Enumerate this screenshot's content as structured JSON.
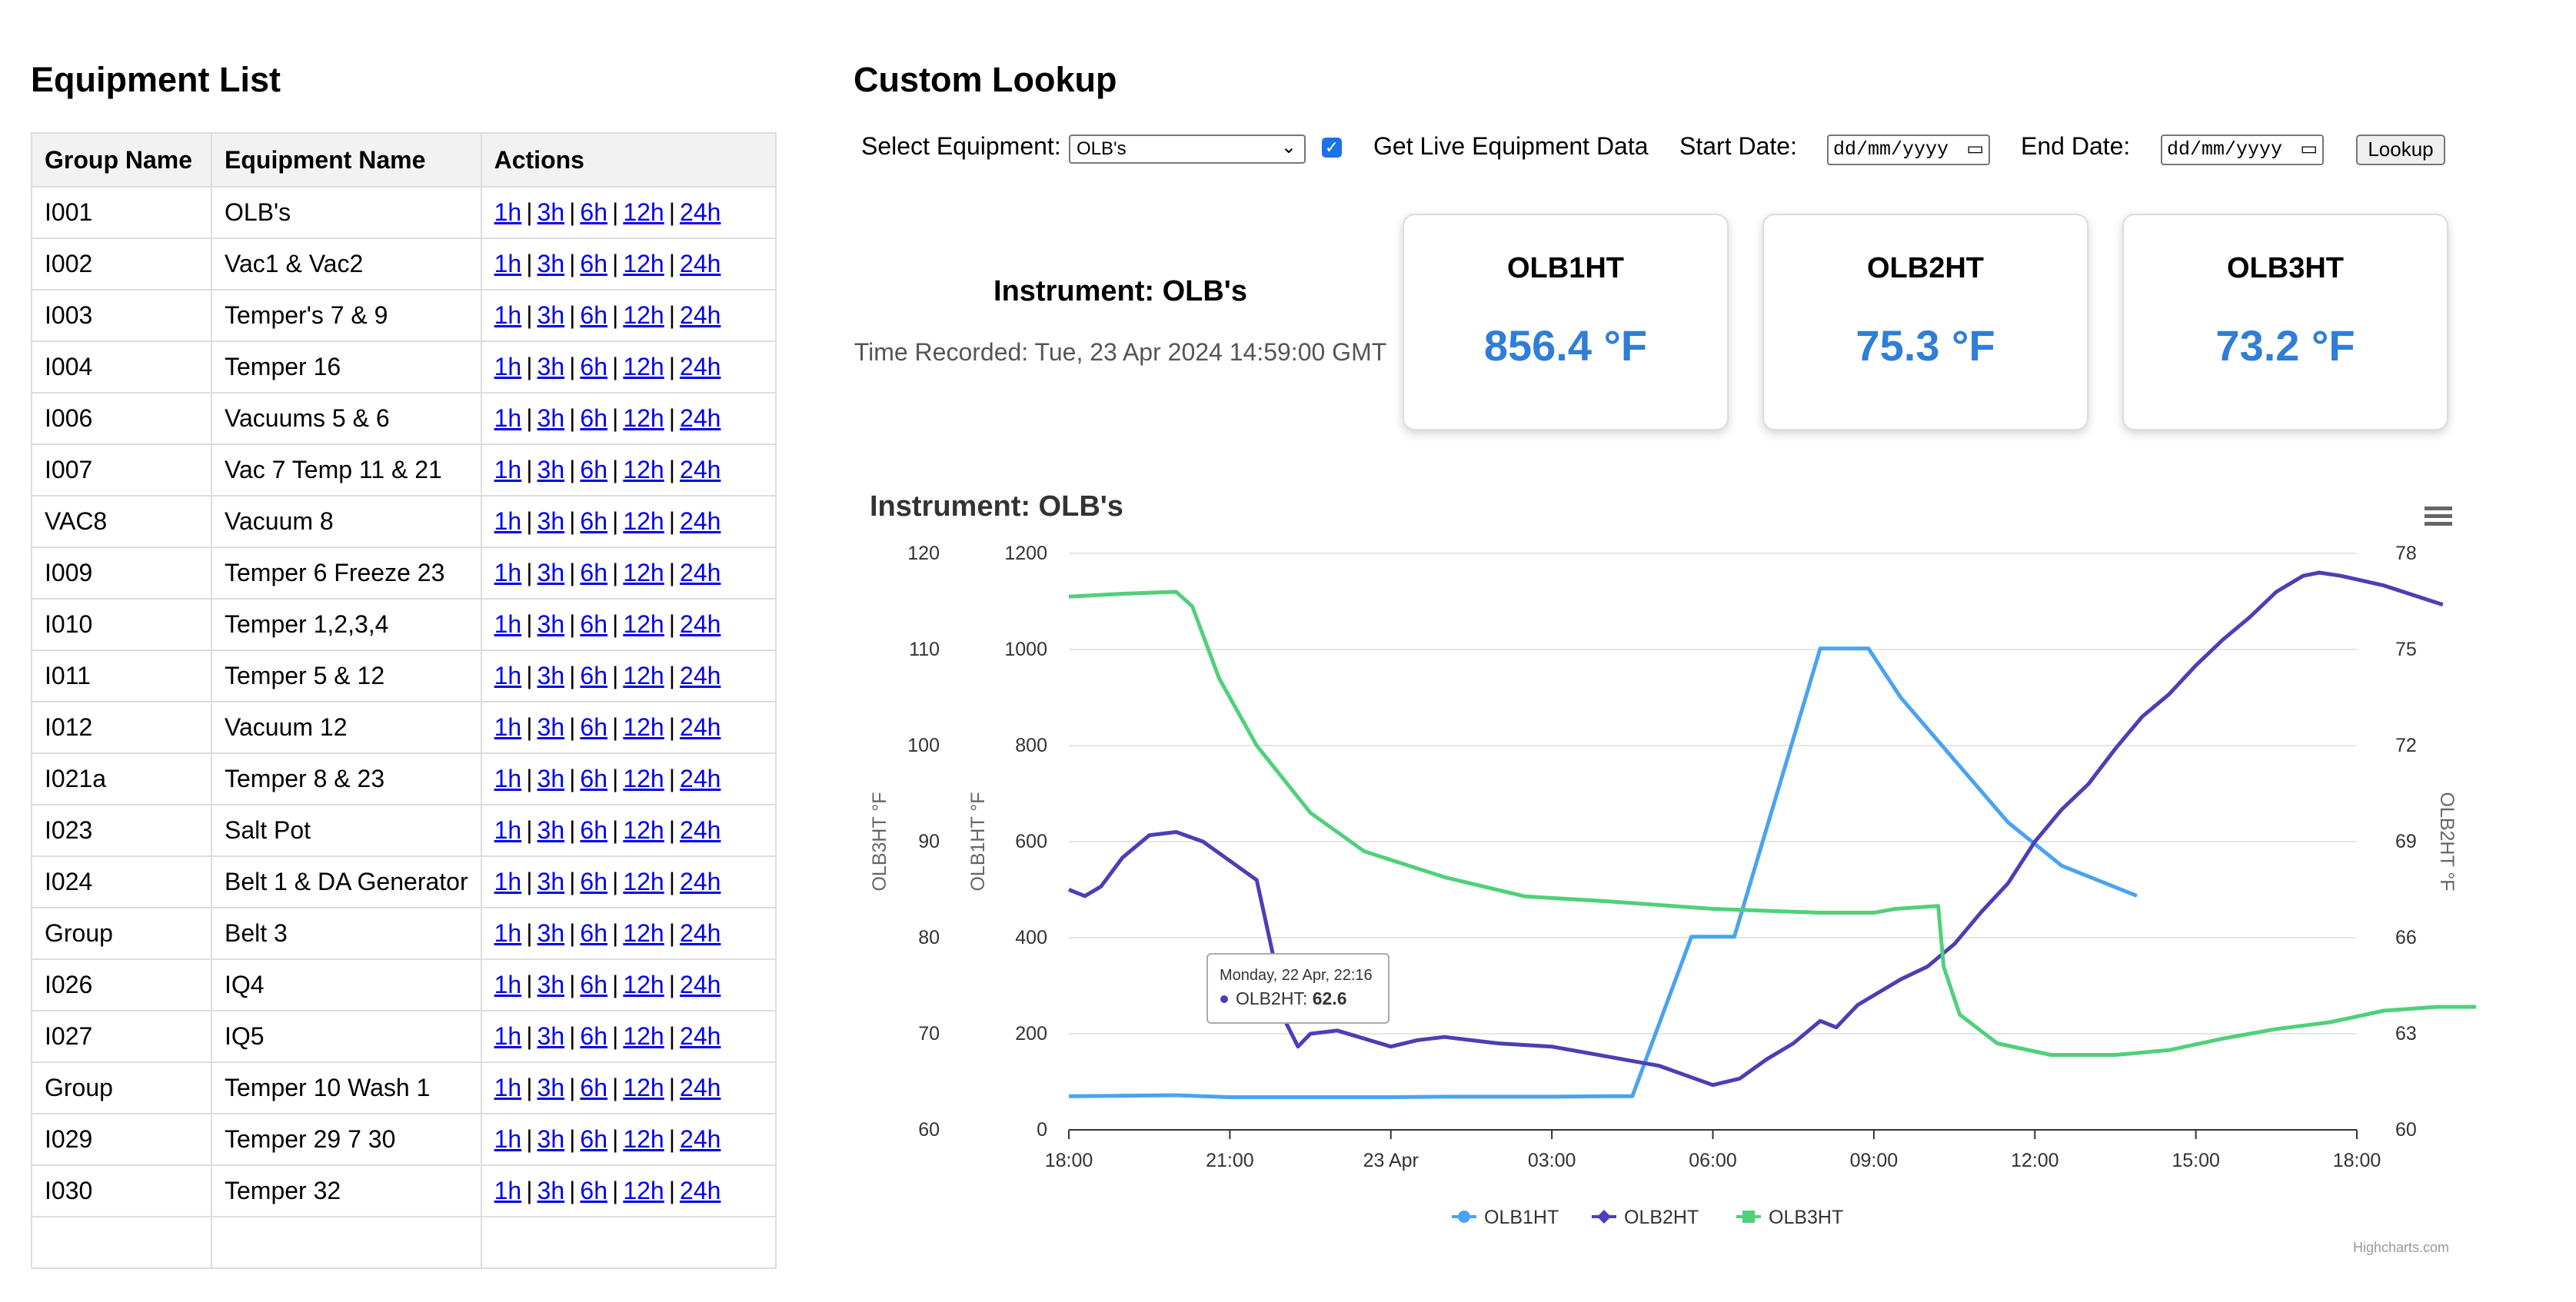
{
  "equipment_list": {
    "title": "Equipment List",
    "headers": [
      "Group Name",
      "Equipment Name",
      "Actions"
    ],
    "actions": [
      "1h",
      "3h",
      "6h",
      "12h",
      "24h"
    ],
    "rows": [
      {
        "group": "I001",
        "name": "OLB's"
      },
      {
        "group": "I002",
        "name": "Vac1 & Vac2"
      },
      {
        "group": "I003",
        "name": "Temper's 7 & 9"
      },
      {
        "group": "I004",
        "name": "Temper 16"
      },
      {
        "group": "I006",
        "name": "Vacuums 5 & 6"
      },
      {
        "group": "I007",
        "name": "Vac 7 Temp 11 & 21"
      },
      {
        "group": "VAC8",
        "name": "Vacuum 8"
      },
      {
        "group": "I009",
        "name": "Temper 6 Freeze 23"
      },
      {
        "group": "I010",
        "name": "Temper 1,2,3,4"
      },
      {
        "group": "I011",
        "name": "Temper 5 & 12"
      },
      {
        "group": "I012",
        "name": "Vacuum 12"
      },
      {
        "group": "I021a",
        "name": "Temper 8 & 23"
      },
      {
        "group": "I023",
        "name": "Salt Pot"
      },
      {
        "group": "I024",
        "name": "Belt 1 & DA Generator"
      },
      {
        "group": "Group",
        "name": "Belt 3"
      },
      {
        "group": "I026",
        "name": "IQ4"
      },
      {
        "group": "I027",
        "name": "IQ5"
      },
      {
        "group": "Group",
        "name": "Temper 10 Wash 1"
      },
      {
        "group": "I029",
        "name": "Temper 29 7 30"
      },
      {
        "group": "I030",
        "name": "Temper 32"
      },
      {
        "group": "",
        "name": ""
      }
    ]
  },
  "custom_lookup": {
    "title": "Custom Lookup",
    "select_label": "Select Equipment:",
    "select_value": "OLB's",
    "live_checked": true,
    "live_label": "Get Live Equipment Data",
    "start_label": "Start Date:",
    "start_placeholder": "dd/mm/yyyy",
    "end_label": "End Date:",
    "end_placeholder": "dd/mm/yyyy",
    "lookup_button": "Lookup"
  },
  "instrument": {
    "name": "Instrument: OLB's",
    "time_recorded": "Time Recorded: Tue, 23 Apr 2024 14:59:00 GMT",
    "cards": [
      {
        "name": "OLB1HT",
        "value": "856.4 °F"
      },
      {
        "name": "OLB2HT",
        "value": "75.3 °F"
      },
      {
        "name": "OLB3HT",
        "value": "73.2 °F"
      }
    ]
  },
  "chart_data": {
    "type": "line",
    "title": "Instrument: OLB's",
    "x_ticks": [
      "18:00",
      "21:00",
      "23 Apr",
      "03:00",
      "06:00",
      "09:00",
      "12:00",
      "15:00",
      "18:00"
    ],
    "x_range_hours": [
      0,
      24
    ],
    "credits": "Highcharts.com",
    "tooltip": {
      "date": "Monday, 22 Apr, 22:16",
      "series": "OLB2HT",
      "value": "62.6"
    },
    "axes": [
      {
        "id": "olb3",
        "label": "OLB3HT °F",
        "min": 60,
        "max": 120,
        "ticks": [
          60,
          70,
          80,
          90,
          100,
          110,
          120
        ]
      },
      {
        "id": "olb1",
        "label": "OLB1HT °F",
        "min": 0,
        "max": 1200,
        "ticks": [
          0,
          200,
          400,
          600,
          800,
          1000,
          1200
        ]
      },
      {
        "id": "olb2",
        "label": "OLB2HT °F",
        "min": 60,
        "max": 78,
        "ticks": [
          60,
          63,
          66,
          69,
          72,
          75,
          78
        ]
      }
    ],
    "series": [
      {
        "name": "OLB1HT",
        "axis": "olb1",
        "color": "#4aa3f0",
        "points": [
          [
            0,
            70
          ],
          [
            2,
            72
          ],
          [
            3,
            68
          ],
          [
            4.5,
            68
          ],
          [
            6,
            68
          ],
          [
            7,
            69
          ],
          [
            9,
            69
          ],
          [
            10,
            70
          ],
          [
            10.5,
            70
          ],
          [
            11.6,
            402
          ],
          [
            12.4,
            402
          ],
          [
            14,
            1002
          ],
          [
            14.9,
            1002
          ],
          [
            15.5,
            900
          ],
          [
            16.5,
            770
          ],
          [
            17.5,
            640
          ],
          [
            18.5,
            550
          ],
          [
            19.9,
            487
          ]
        ]
      },
      {
        "name": "OLB2HT",
        "axis": "olb2",
        "color": "#4b3fb5",
        "points": [
          [
            0,
            67.5
          ],
          [
            0.3,
            67.3
          ],
          [
            0.6,
            67.6
          ],
          [
            1,
            68.5
          ],
          [
            1.5,
            69.2
          ],
          [
            2,
            69.3
          ],
          [
            2.5,
            69.0
          ],
          [
            3,
            68.4
          ],
          [
            3.5,
            67.8
          ],
          [
            3.8,
            65.5
          ],
          [
            4.0,
            63.5
          ],
          [
            4.27,
            62.6
          ],
          [
            4.5,
            63.0
          ],
          [
            5,
            63.1
          ],
          [
            6,
            62.6
          ],
          [
            6.5,
            62.8
          ],
          [
            7,
            62.9
          ],
          [
            8,
            62.7
          ],
          [
            9,
            62.6
          ],
          [
            10,
            62.3
          ],
          [
            11,
            62.0
          ],
          [
            11.5,
            61.7
          ],
          [
            12,
            61.4
          ],
          [
            12.5,
            61.6
          ],
          [
            13,
            62.2
          ],
          [
            13.5,
            62.7
          ],
          [
            14,
            63.4
          ],
          [
            14.3,
            63.2
          ],
          [
            14.7,
            63.9
          ],
          [
            15,
            64.2
          ],
          [
            15.5,
            64.7
          ],
          [
            16,
            65.1
          ],
          [
            16.5,
            65.8
          ],
          [
            17,
            66.8
          ],
          [
            17.5,
            67.7
          ],
          [
            18,
            69.0
          ],
          [
            18.5,
            70.0
          ],
          [
            19,
            70.8
          ],
          [
            19.5,
            71.9
          ],
          [
            20,
            72.9
          ],
          [
            20.5,
            73.6
          ],
          [
            21,
            74.5
          ],
          [
            21.5,
            75.3
          ],
          [
            22,
            76.0
          ],
          [
            22.5,
            76.8
          ],
          [
            23,
            77.3
          ],
          [
            23.3,
            77.4
          ],
          [
            23.7,
            77.3
          ],
          [
            24.5,
            77.0
          ],
          [
            25.6,
            76.4
          ]
        ]
      },
      {
        "name": "OLB3HT",
        "axis": "olb3",
        "color": "#50d07a",
        "points": [
          [
            0,
            115.5
          ],
          [
            1,
            115.8
          ],
          [
            2,
            116.0
          ],
          [
            2.3,
            114.5
          ],
          [
            2.8,
            107
          ],
          [
            3.5,
            100
          ],
          [
            4.5,
            93
          ],
          [
            5.5,
            89
          ],
          [
            7,
            86.3
          ],
          [
            8.5,
            84.3
          ],
          [
            10,
            83.8
          ],
          [
            12,
            83
          ],
          [
            14,
            82.6
          ],
          [
            15,
            82.6
          ],
          [
            15.4,
            83
          ],
          [
            16.2,
            83.3
          ],
          [
            16.3,
            77
          ],
          [
            16.6,
            72
          ],
          [
            17.3,
            69
          ],
          [
            18.3,
            67.8
          ],
          [
            19.5,
            67.8
          ],
          [
            20.5,
            68.3
          ],
          [
            21.5,
            69.5
          ],
          [
            22.5,
            70.5
          ],
          [
            23.5,
            71.2
          ],
          [
            24.5,
            72.4
          ],
          [
            25.5,
            72.8
          ],
          [
            26.5,
            72.8
          ],
          [
            27,
            72.6
          ],
          [
            28.3,
            72.0
          ]
        ]
      }
    ]
  }
}
